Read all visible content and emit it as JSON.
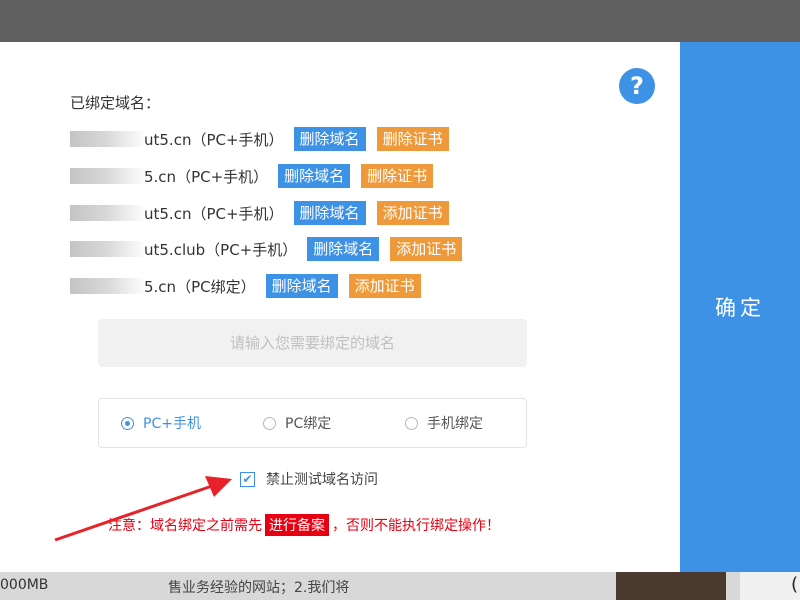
{
  "dialog": {
    "bound_title": "已绑定域名：",
    "help_icon": "?",
    "confirm_label": "确定",
    "domains": [
      {
        "name": "ut5.cn（PC+手机）",
        "delete_label": "删除域名",
        "cert_label": "删除证书"
      },
      {
        "name": "5.cn（PC+手机）",
        "delete_label": "删除域名",
        "cert_label": "删除证书"
      },
      {
        "name": "ut5.cn（PC+手机）",
        "delete_label": "删除域名",
        "cert_label": "添加证书"
      },
      {
        "name": "ut5.club（PC+手机）",
        "delete_label": "删除域名",
        "cert_label": "添加证书"
      },
      {
        "name": "5.cn（PC绑定）",
        "delete_label": "删除域名",
        "cert_label": "添加证书"
      }
    ],
    "input_placeholder": "请输入您需要绑定的域名",
    "radio_options": [
      {
        "label": "PC+手机",
        "checked": true
      },
      {
        "label": "PC绑定",
        "checked": false
      },
      {
        "label": "手机绑定",
        "checked": false
      }
    ],
    "checkbox": {
      "label": "禁止测试域名访问",
      "checked": true
    },
    "notice": {
      "prefix": "注意：域名绑定之前需先",
      "highlight": "进行备案",
      "suffix": "，否则不能执行绑定操作！"
    }
  },
  "background": {
    "bottom_left": "000MB",
    "bottom_mid": "售业务经验的网站；2.我们将"
  },
  "colors": {
    "primary": "#3e92e6",
    "orange": "#ef9a3a",
    "danger": "#e60012"
  }
}
